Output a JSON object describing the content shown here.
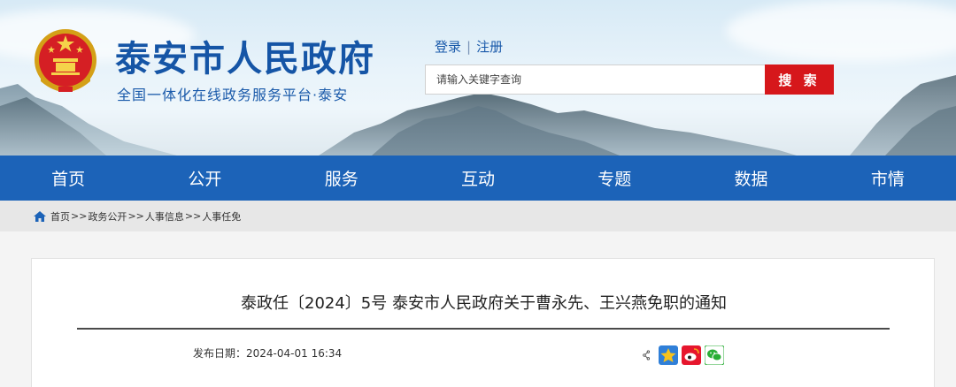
{
  "header": {
    "site_title": "泰安市人民政府",
    "site_subtitle": "全国一体化在线政务服务平台·泰安",
    "login_label": "登录",
    "separator": "|",
    "register_label": "注册",
    "search": {
      "placeholder": "请输入关键字查询",
      "button_label": "搜 索"
    }
  },
  "nav": {
    "items": [
      {
        "label": "首页"
      },
      {
        "label": "公开"
      },
      {
        "label": "服务"
      },
      {
        "label": "互动"
      },
      {
        "label": "专题"
      },
      {
        "label": "数据"
      },
      {
        "label": "市情"
      }
    ]
  },
  "breadcrumb": {
    "items": [
      "首页",
      "政务公开",
      "人事信息",
      "人事任免"
    ],
    "separator": ">>"
  },
  "article": {
    "title": "泰政任〔2024〕5号 泰安市人民政府关于曹永先、王兴燕免职的通知",
    "date_label": "发布日期：",
    "date_value": "2024-04-01 16:34"
  },
  "share_icons": [
    "share-icon",
    "qzone-icon",
    "weibo-icon",
    "wechat-icon"
  ],
  "colors": {
    "brand_blue": "#1c63b8",
    "title_blue": "#1555a6",
    "search_red": "#d6171b"
  }
}
